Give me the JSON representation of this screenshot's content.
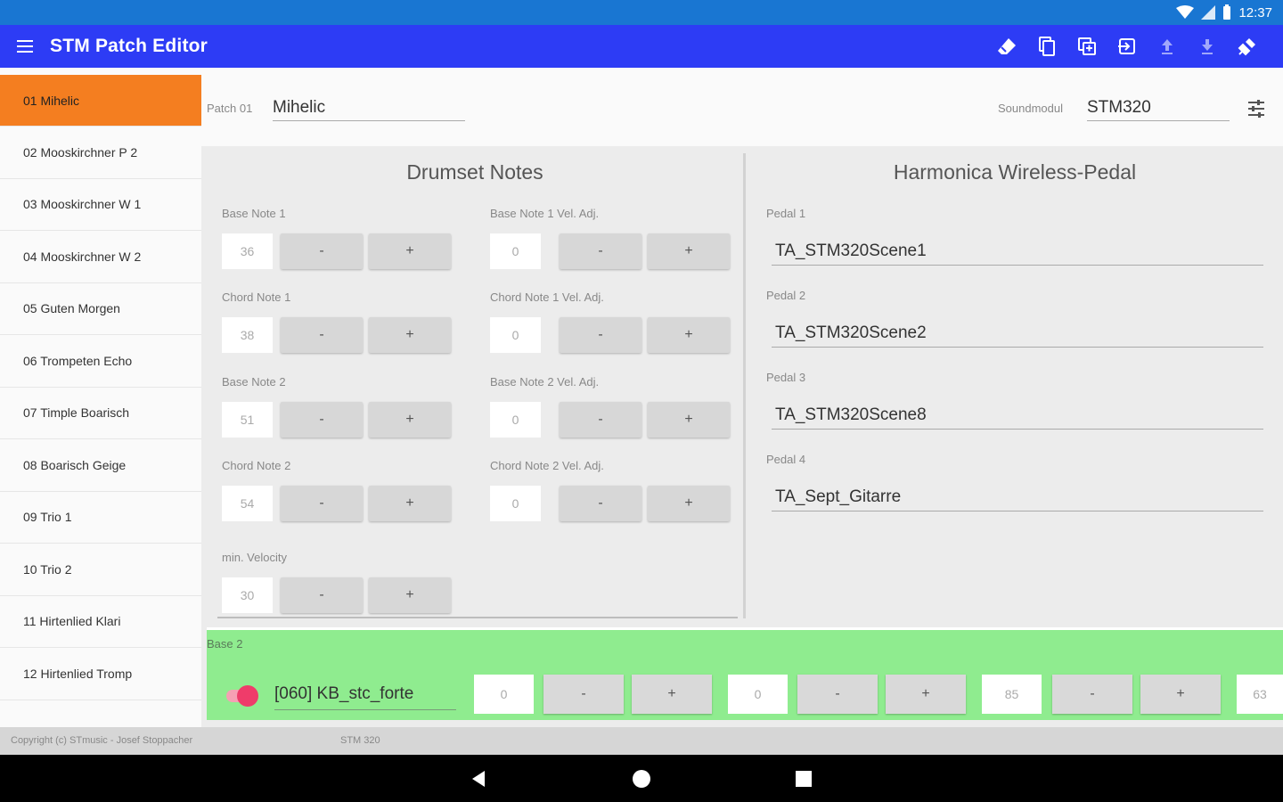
{
  "status_bar": {
    "time": "12:37"
  },
  "app_bar": {
    "title": "STM Patch Editor"
  },
  "sidebar": {
    "items": [
      {
        "label": "01 Mihelic"
      },
      {
        "label": "02 Mooskirchner P 2"
      },
      {
        "label": "03 Mooskirchner W 1"
      },
      {
        "label": "04 Mooskirchner W 2"
      },
      {
        "label": "05 Guten Morgen"
      },
      {
        "label": "06 Trompeten Echo"
      },
      {
        "label": "07 Timple Boarisch"
      },
      {
        "label": "08 Boarisch Geige"
      },
      {
        "label": "09 Trio 1"
      },
      {
        "label": "10 Trio 2"
      },
      {
        "label": "11 Hirtenlied Klari"
      },
      {
        "label": "12 Hirtenlied Tromp"
      }
    ]
  },
  "patch": {
    "label": "Patch 01",
    "name": "Mihelic",
    "soundmodul_label": "Soundmodul",
    "soundmodul_value": "STM320"
  },
  "drumset": {
    "title": "Drumset Notes",
    "minus": "-",
    "plus": "+",
    "fields": [
      {
        "label": "Base Note 1",
        "value": "36"
      },
      {
        "label": "Base Note 1 Vel. Adj.",
        "value": "0"
      },
      {
        "label": "Chord Note 1",
        "value": "38"
      },
      {
        "label": "Chord Note 1 Vel. Adj.",
        "value": "0"
      },
      {
        "label": "Base Note 2",
        "value": "51"
      },
      {
        "label": "Base Note 2 Vel. Adj.",
        "value": "0"
      },
      {
        "label": "Chord Note 2",
        "value": "54"
      },
      {
        "label": "Chord Note 2 Vel. Adj.",
        "value": "0"
      }
    ],
    "min_velocity": {
      "label": "min. Velocity",
      "value": "30"
    }
  },
  "pedal": {
    "title": "Harmonica Wireless-Pedal",
    "items": [
      {
        "label": "Pedal 1",
        "value": "TA_STM320Scene1"
      },
      {
        "label": "Pedal 2",
        "value": "TA_STM320Scene2"
      },
      {
        "label": "Pedal 3",
        "value": "TA_STM320Scene8"
      },
      {
        "label": "Pedal 4",
        "value": "TA_Sept_Gitarre"
      }
    ]
  },
  "base2": {
    "label": "Base 2",
    "toggle_on": true,
    "sound": "[060] KB_stc_forte",
    "values": [
      "0",
      "0",
      "85",
      "63"
    ],
    "minus": "-",
    "plus": "+"
  },
  "footer": {
    "copyright": "Copyright (c) STmusic - Josef Stoppacher",
    "module": "STM 320"
  },
  "colors": {
    "app_bar": "#2d3cf5",
    "status_bar": "#1976d2",
    "active_item": "#f47e20",
    "green_bar": "#8fec8f",
    "toggle": "#ef3c6a"
  }
}
